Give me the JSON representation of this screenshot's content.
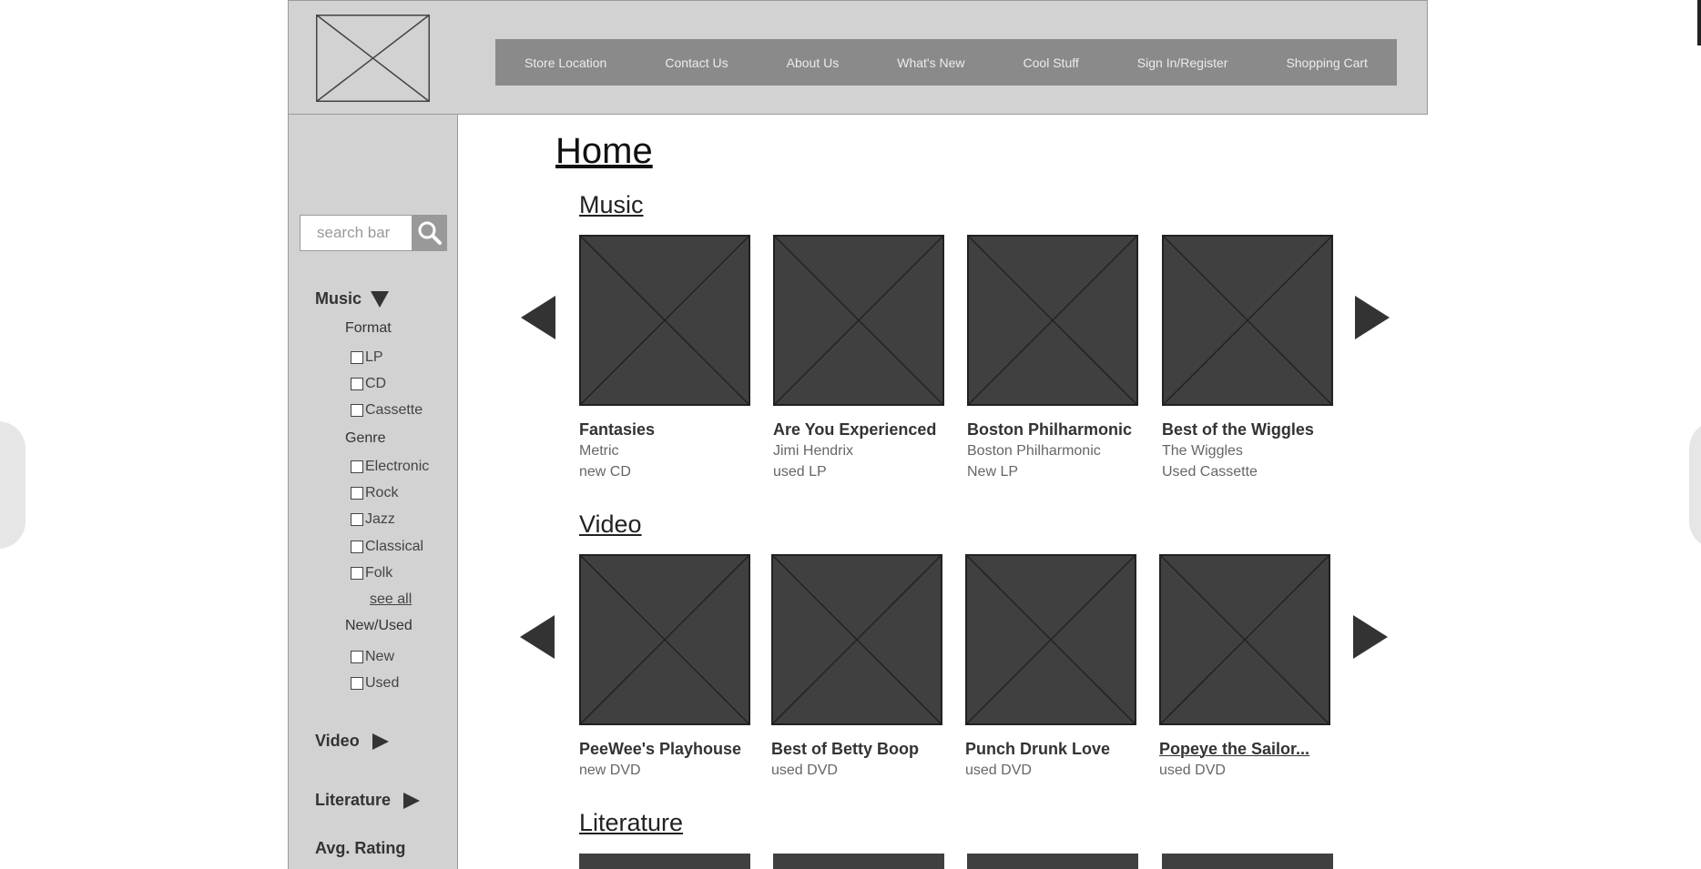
{
  "header": {
    "nav": [
      "Store Location",
      "Contact Us",
      "About Us",
      "What's New",
      "Cool Stuff",
      "Sign In/Register",
      "Shopping Cart"
    ]
  },
  "sidebar": {
    "search_placeholder": "search bar",
    "music_label": "Music",
    "format_label": "Format",
    "format_options": [
      "LP",
      "CD",
      "Cassette"
    ],
    "genre_label": "Genre",
    "genre_options": [
      "Electronic",
      "Rock",
      "Jazz",
      "Classical",
      "Folk"
    ],
    "see_all": "see all",
    "newused_label": "New/Used",
    "newused_options": [
      "New",
      "Used"
    ],
    "video_label": "Video",
    "literature_label": "Literature",
    "rating_label": "Avg. Rating"
  },
  "main": {
    "title": "Home",
    "music": {
      "title": "Music",
      "items": [
        {
          "title": "Fantasies",
          "artist": "Metric",
          "condition": "new CD"
        },
        {
          "title": "Are You Experienced",
          "artist": "Jimi Hendrix",
          "condition": "used LP"
        },
        {
          "title": "Boston Philharmonic",
          "artist": "Boston Philharmonic",
          "condition": "New LP"
        },
        {
          "title": "Best of the Wiggles",
          "artist": "The Wiggles",
          "condition": "Used Cassette"
        }
      ]
    },
    "video": {
      "title": "Video",
      "items": [
        {
          "title": "PeeWee's Playhouse",
          "condition": "new DVD"
        },
        {
          "title": "Best of Betty Boop",
          "condition": "used DVD"
        },
        {
          "title": "Punch Drunk Love",
          "condition": "used DVD"
        },
        {
          "title": "Popeye the Sailor...",
          "condition": "used DVD"
        }
      ]
    },
    "literature": {
      "title": "Literature"
    }
  },
  "colors": {
    "header_bg": "#d2d2d2",
    "nav_bg": "#8a8a8a",
    "thumb_bg": "#404040",
    "sidebar_bg": "#d2d2d2"
  }
}
